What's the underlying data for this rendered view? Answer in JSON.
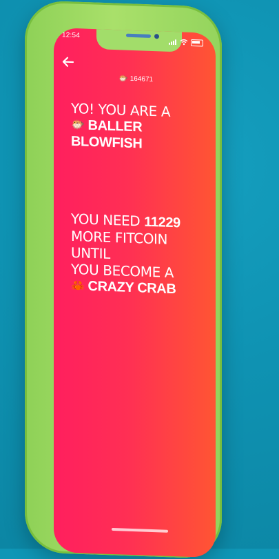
{
  "status_bar": {
    "time": "12:54"
  },
  "header": {
    "coin_balance": "164671",
    "coin_icon": "blowfish-emoji"
  },
  "message": {
    "line1": "YO! YOU ARE A",
    "current_rank_emoji": "🐡",
    "current_rank_name_line1": "BALLER",
    "current_rank_name_line2": "BLOWFISH",
    "need_prefix": "YOU NEED",
    "need_amount": "11229",
    "more_fitcoin": "MORE FITCOIN",
    "until": "UNTIL",
    "become_prefix": "YOU BECOME A",
    "next_rank_emoji": "🦀",
    "next_rank_name": "CRAZY CRAB"
  },
  "colors": {
    "screen_gradient_start": "#ff1f5e",
    "screen_gradient_end": "#ff5533",
    "phone_frame": "#a9e06a",
    "background": "#0f96b6"
  }
}
